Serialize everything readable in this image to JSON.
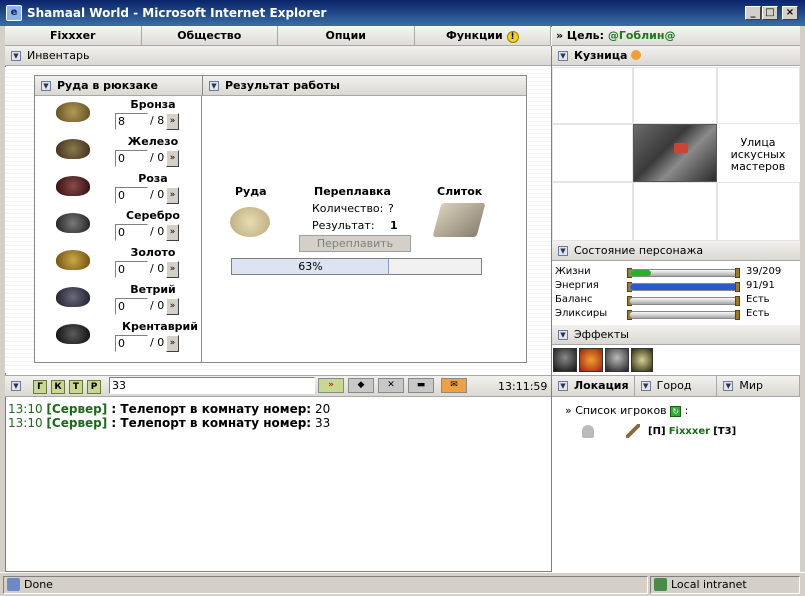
{
  "window": {
    "title": "Shamaal World - Microsoft Internet Explorer",
    "buttons": [
      "_",
      "□",
      "×"
    ]
  },
  "menu": {
    "items": [
      "Fixxxer",
      "Общество",
      "Опции",
      "Функции"
    ],
    "functions_alert_icon": "!"
  },
  "goal": {
    "label": "» Цель: ",
    "target": "@Гоблин@"
  },
  "inventory": {
    "header": "Инвентарь",
    "ore_header": "Руда в рюкзаке",
    "result_header": "Результат работы",
    "ores": [
      {
        "name": "Бронза",
        "value": "8",
        "max": "/ 8",
        "color": "#8a6a2a"
      },
      {
        "name": "Железо",
        "value": "0",
        "max": "/ 0",
        "color": "#5a4a2a"
      },
      {
        "name": "Роза",
        "value": "0",
        "max": "/ 0",
        "color": "#5a2a2a"
      },
      {
        "name": "Серебро",
        "value": "0",
        "max": "/ 0",
        "color": "#3a3a3a"
      },
      {
        "name": "Золото",
        "value": "0",
        "max": "/ 0",
        "color": "#9a7a2a"
      },
      {
        "name": "Ветрий",
        "value": "0",
        "max": "/ 0",
        "color": "#3a3a44"
      },
      {
        "name": "Крентаврий",
        "value": "0",
        "max": "/ 0",
        "color": "#1a1a1a"
      }
    ],
    "arrow": "»",
    "result": {
      "ore_label": "Руда",
      "smelt_label": "Переплавка",
      "ingot_label": "Слиток",
      "quantity_label": "Количество:",
      "quantity_value": "?",
      "result_label": "Результат:",
      "result_value": "1",
      "smelt_button": "Переплавить",
      "progress_text": "63%",
      "progress": 0.63
    }
  },
  "forge": {
    "header": "Кузница",
    "location_text": "Улица искусных мастеров"
  },
  "status": {
    "header": "Состояние персонажа",
    "rows": [
      {
        "label": "Жизни",
        "value": "39/209",
        "fill": 0.19,
        "color": "#2cb02c"
      },
      {
        "label": "Энергия",
        "value": "91/91",
        "fill": 1.0,
        "color": "#2a5acc"
      },
      {
        "label": "Баланс",
        "value": "Есть",
        "fill": 0,
        "color": "#888888"
      },
      {
        "label": "Эликсиры",
        "value": "Есть",
        "fill": 0,
        "color": "#888888"
      }
    ]
  },
  "effects": {
    "header": "Эффекты",
    "icons": [
      "hooded-figure-icon",
      "fire-shield-icon",
      "skeleton-icon",
      "eye-icon"
    ]
  },
  "chat": {
    "buttons": [
      "Г",
      "К",
      "Т",
      "Р"
    ],
    "input_value": "33",
    "time": "13:11:59",
    "toolbar_icons": [
      "send-icon",
      "potion-icon",
      "swords-icon",
      "bag-icon",
      "mail-icon"
    ],
    "messages": [
      {
        "time": "13:10",
        "sender": "[Сервер]",
        "sep": " : ",
        "text": "Телепорт в комнату номер:",
        "value": "20"
      },
      {
        "time": "13:10",
        "sender": "[Сервер]",
        "sep": " : ",
        "text": "Телепорт в комнату номер:",
        "value": "33"
      }
    ]
  },
  "location_tabs": [
    "Локация",
    "Город",
    "Мир"
  ],
  "players": {
    "label": "» Список игроков",
    "colon": ":",
    "entries": [
      {
        "clan": "[П]",
        "name": "Fixxxer",
        "level": "[Т3]"
      }
    ]
  },
  "statusbar": {
    "left": "Done",
    "zone": "Local intranet"
  }
}
